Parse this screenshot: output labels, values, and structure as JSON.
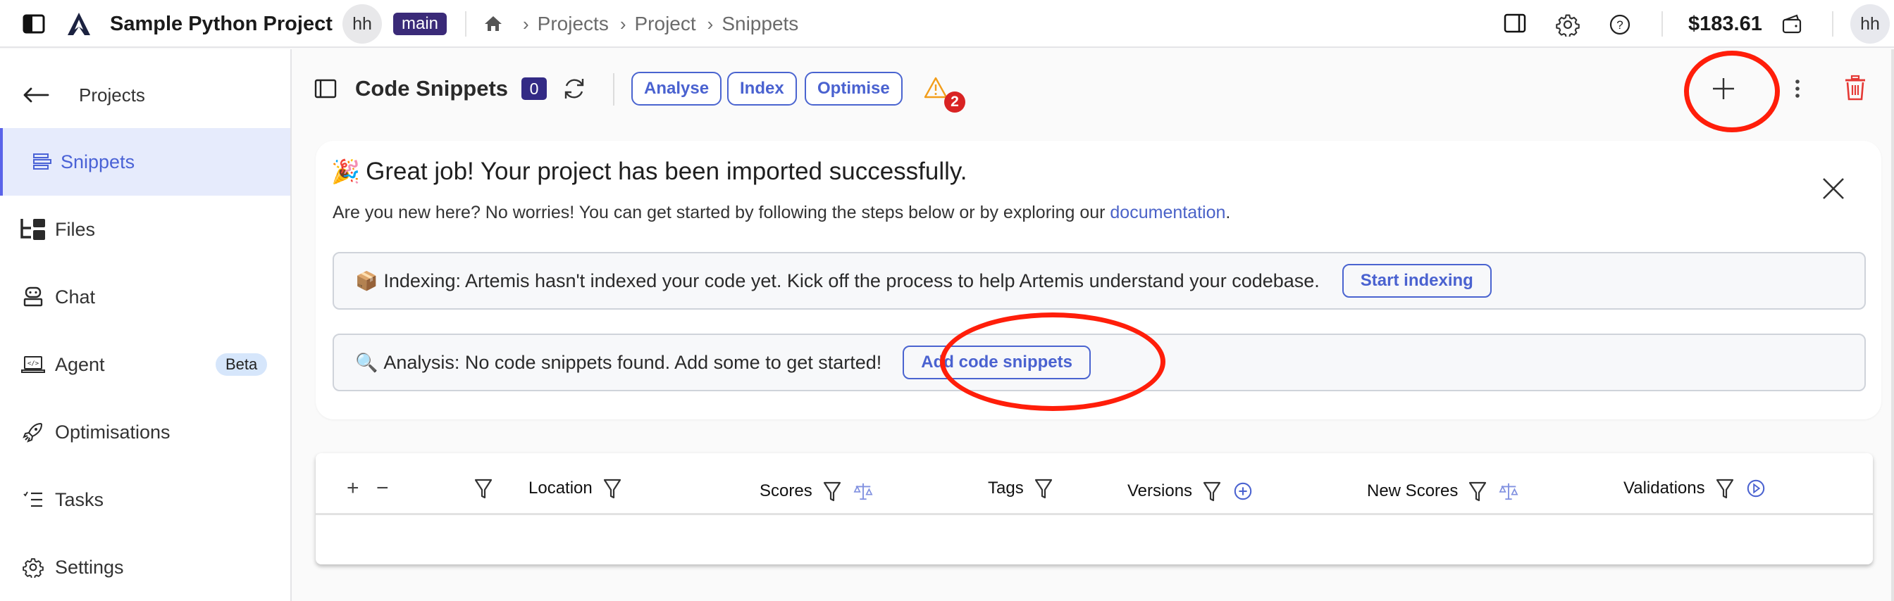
{
  "topbar": {
    "project_name": "Sample Python Project",
    "user_initials": "hh",
    "branch": "main",
    "breadcrumb": [
      "Projects",
      "Project",
      "Snippets"
    ],
    "balance": "$183.61",
    "icons": [
      "sidebar-toggle-icon",
      "app-logo",
      "home-icon",
      "panel-icon",
      "gear-icon",
      "help-icon",
      "wallet-icon"
    ]
  },
  "sidebar": {
    "back_label": "Projects",
    "items": [
      {
        "label": "Snippets",
        "icon": "snippets-icon",
        "active": true
      },
      {
        "label": "Files",
        "icon": "files-icon"
      },
      {
        "label": "Chat",
        "icon": "chat-icon"
      },
      {
        "label": "Agent",
        "icon": "agent-icon",
        "badge": "Beta"
      },
      {
        "label": "Optimisations",
        "icon": "rocket-icon"
      },
      {
        "label": "Tasks",
        "icon": "tasks-icon"
      },
      {
        "label": "Settings",
        "icon": "settings-icon"
      }
    ]
  },
  "main": {
    "title": "Code Snippets",
    "count": "0",
    "actions": [
      "Analyse",
      "Index",
      "Optimise"
    ],
    "warning_count": "2"
  },
  "onboarding": {
    "emoji": "🎉",
    "title": "Great job! Your project has been imported successfully.",
    "subtitle_prefix": "Are you new here? No worries! You can get started by following the steps below or by exploring our ",
    "subtitle_link": "documentation",
    "subtitle_suffix": ".",
    "steps": [
      {
        "emoji": "📦",
        "text": "Indexing: Artemis hasn't indexed your code yet. Kick off the process to help Artemis understand your codebase.",
        "button": "Start indexing"
      },
      {
        "emoji": "🔍",
        "text": "Analysis: No code snippets found. Add some to get started!",
        "button": "Add code snippets"
      }
    ]
  },
  "table": {
    "expand_symbol": "+",
    "collapse_symbol": "−",
    "columns": [
      "Location",
      "Scores",
      "Tags",
      "Versions",
      "New Scores",
      "Validations"
    ],
    "rows": []
  },
  "colors": {
    "accent": "#4a62d0",
    "branch_badge": "#3a2a78",
    "active_nav_bg": "#e6ebfc",
    "danger": "#e53935",
    "warning": "#f29d1a",
    "annotation": "#ff1e0a"
  }
}
